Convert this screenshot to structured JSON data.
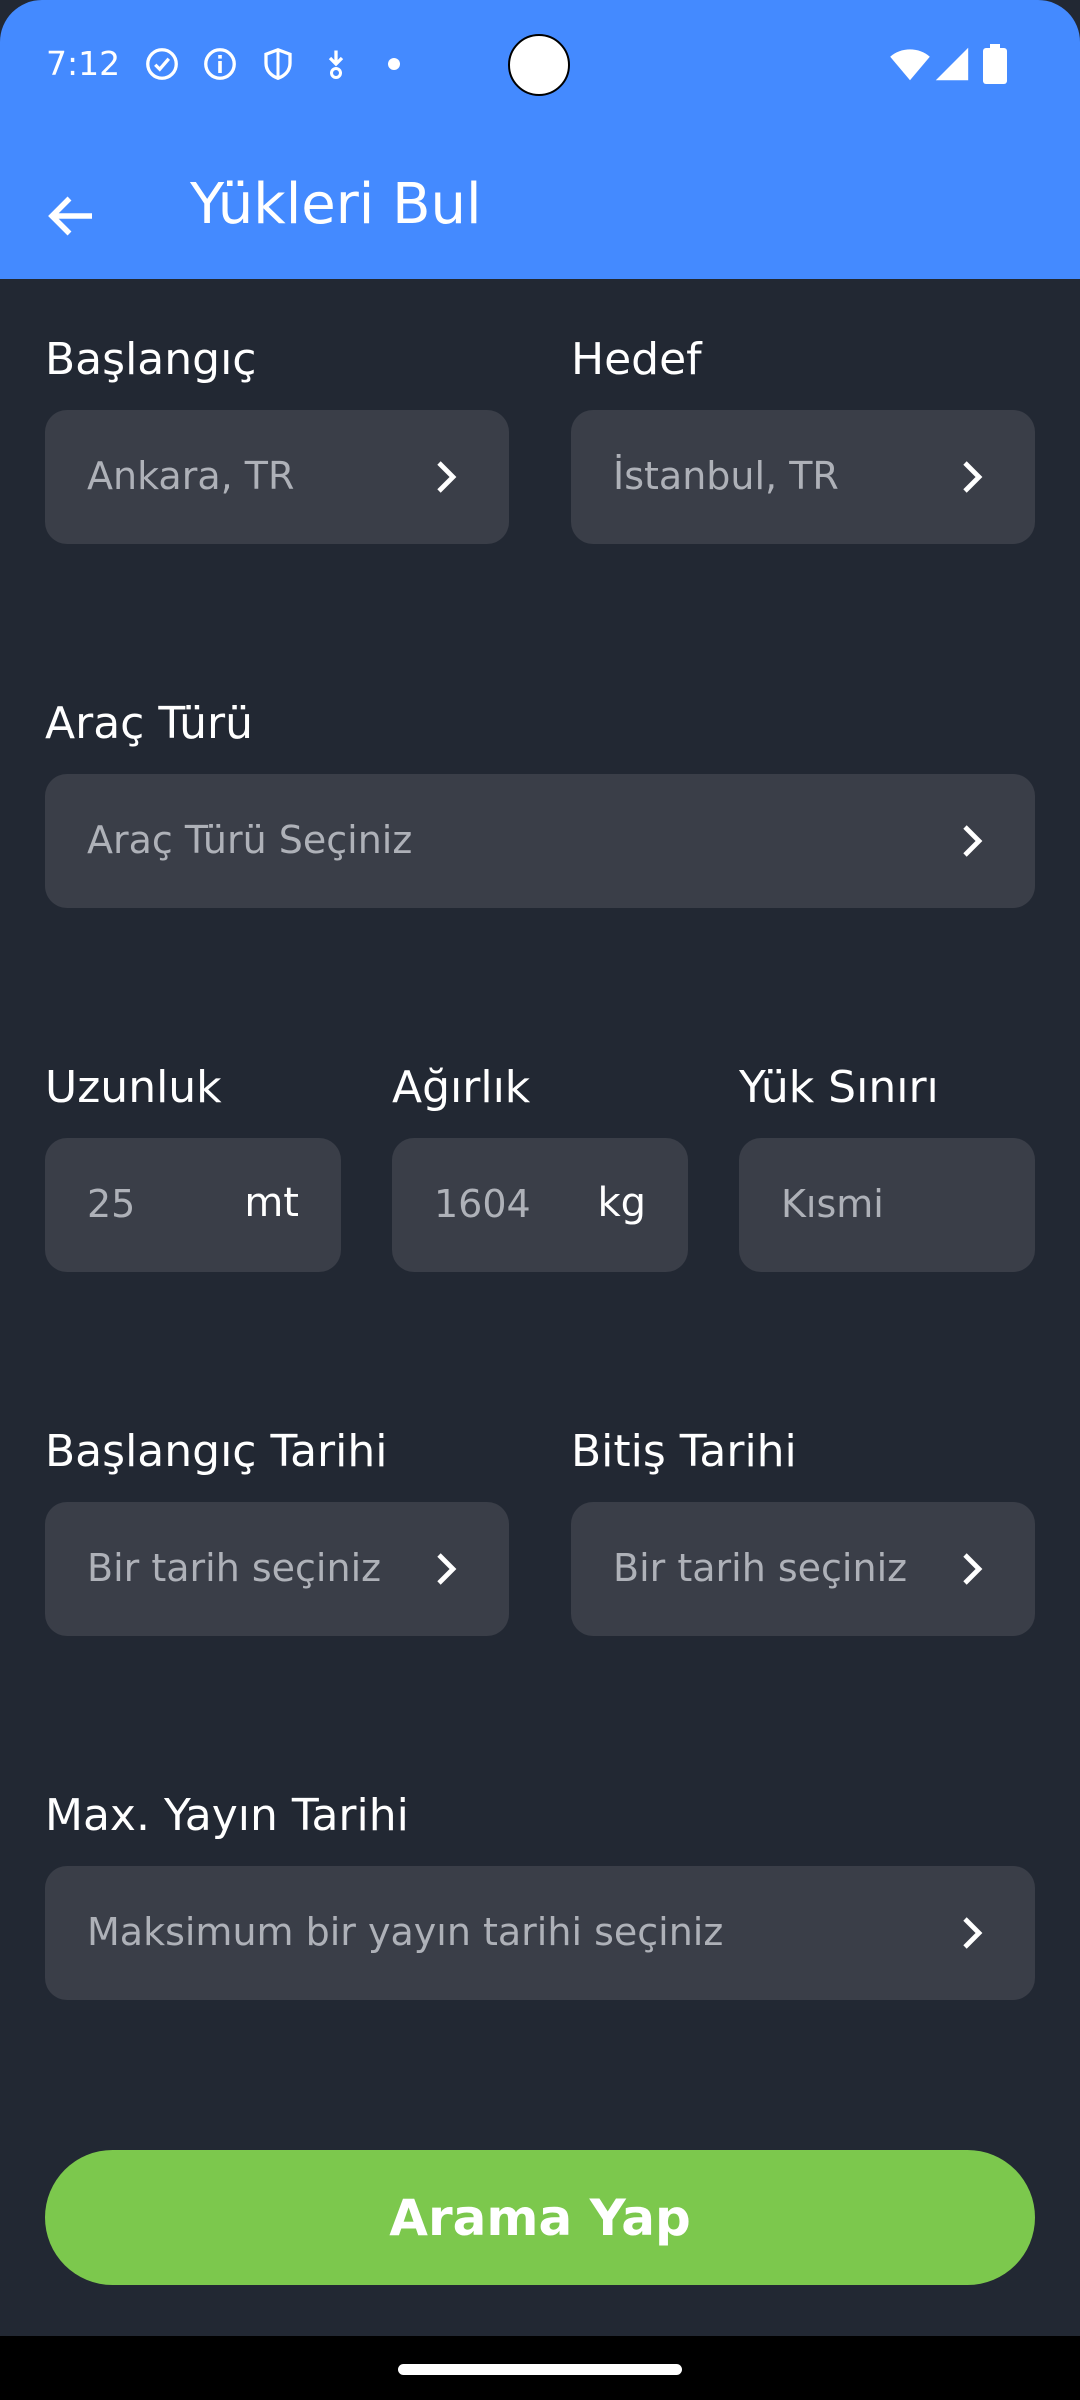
{
  "status_bar": {
    "time": "7:12",
    "left_icons": [
      "check-circle-icon",
      "info-icon",
      "shield-icon",
      "download-icon",
      "dot-icon"
    ],
    "right_icons": [
      "wifi-icon",
      "cellular-signal-icon",
      "battery-icon"
    ]
  },
  "colors": {
    "primary": "#448AFF",
    "background": "#222833",
    "field": "#3A3E48",
    "accent_button": "#7CC84D"
  },
  "app_bar": {
    "title": "Yükleri Bul",
    "back_icon": "arrow-back-icon"
  },
  "form": {
    "origin": {
      "label": "Başlangıç",
      "value": "Ankara, TR"
    },
    "destination": {
      "label": "Hedef",
      "value": "İstanbul, TR"
    },
    "vehicle_type": {
      "label": "Araç Türü",
      "placeholder": "Araç Türü Seçiniz"
    },
    "length": {
      "label": "Uzunluk",
      "value": "25",
      "unit": "mt"
    },
    "weight": {
      "label": "Ağırlık",
      "value": "1604",
      "unit": "kg"
    },
    "load_limit": {
      "label": "Yük Sınırı",
      "value": "Kısmi"
    },
    "start_date": {
      "label": "Başlangıç Tarihi",
      "placeholder": "Bir tarih seçiniz"
    },
    "end_date": {
      "label": "Bitiş Tarihi",
      "placeholder": "Bir tarih seçiniz"
    },
    "max_publish_date": {
      "label": "Max. Yayın Tarihi",
      "placeholder": "Maksimum bir yayın tarihi seçiniz"
    }
  },
  "search_button": {
    "label": "Arama Yap"
  }
}
